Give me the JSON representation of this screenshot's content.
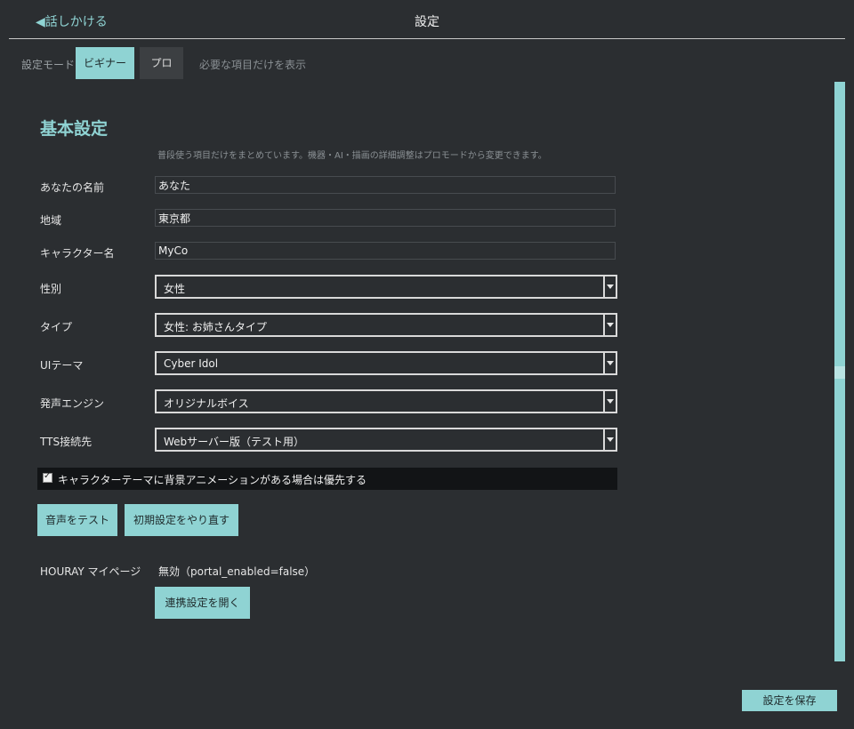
{
  "header": {
    "back_label": "◀話しかける",
    "title": "設定"
  },
  "mode": {
    "label": "設定モード",
    "beginner": "ビギナー",
    "pro": "プロ",
    "hint": "必要な項目だけを表示",
    "selected": "ビギナー"
  },
  "section": {
    "title": "基本設定",
    "description": "普段使う項目だけをまとめています。機器・AI・描画の詳細調整はプロモードから変更できます。"
  },
  "fields": {
    "name": {
      "label": "あなたの名前",
      "value": "あなた"
    },
    "region": {
      "label": "地域",
      "value": "東京都"
    },
    "character_name": {
      "label": "キャラクター名",
      "value": "MyCo"
    }
  },
  "selects": {
    "gender": {
      "label": "性別",
      "value": "女性"
    },
    "type": {
      "label": "タイプ",
      "value": "女性: お姉さんタイプ"
    },
    "ui_theme": {
      "label": "UIテーマ",
      "value": "Cyber Idol"
    },
    "voice_engine": {
      "label": "発声エンジン",
      "value": "オリジナルボイス"
    },
    "tts_endpoint": {
      "label": "TTS接続先",
      "value": "Webサーバー版（テスト用）"
    }
  },
  "checkbox": {
    "label": "キャラクターテーマに背景アニメーションがある場合は優先する",
    "checked": true
  },
  "buttons": {
    "test_voice": "音声をテスト",
    "reset": "初期設定をやり直す",
    "open_link": "連携設定を開く",
    "save": "設定を保存"
  },
  "portal": {
    "label": "HOURAY マイページ",
    "value": "無効（portal_enabled=false）"
  },
  "colors": {
    "accent": "#8fd3d3",
    "background": "#2b2e31"
  }
}
